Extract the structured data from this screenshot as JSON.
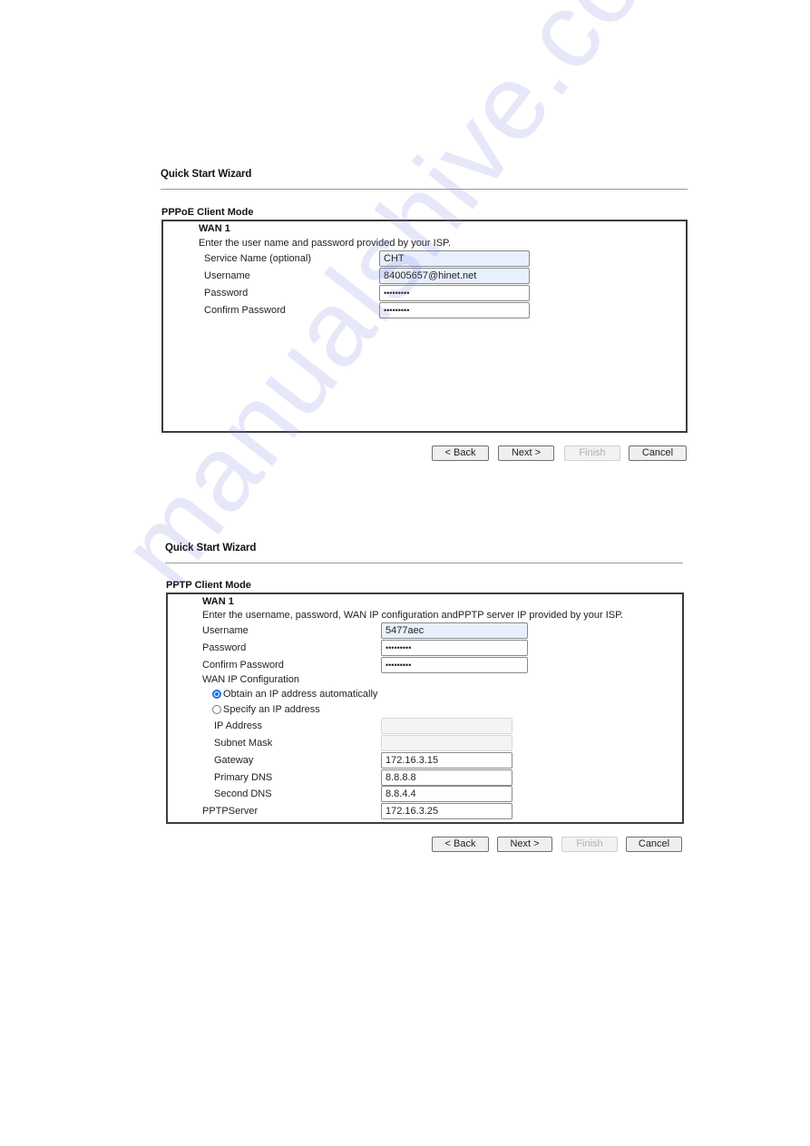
{
  "watermark": "manualshive.com",
  "pppoe": {
    "wizard_title": "Quick Start Wizard",
    "mode_title": "PPPoE Client Mode",
    "wan_label": "WAN 1",
    "description": "Enter the user name and password provided by your ISP.",
    "fields": {
      "service_name": {
        "label": "Service Name (optional)",
        "value": "CHT"
      },
      "username": {
        "label": "Username",
        "value": "84005657@hinet.net"
      },
      "password": {
        "label": "Password",
        "value": "•••••••••"
      },
      "confirm_password": {
        "label": "Confirm Password",
        "value": "•••••••••"
      }
    },
    "buttons": {
      "back": "< Back",
      "next": "Next >",
      "finish": "Finish",
      "cancel": "Cancel"
    }
  },
  "pptp": {
    "wizard_title": "Quick Start Wizard",
    "mode_title": "PPTP Client Mode",
    "wan_label": "WAN 1",
    "description": "Enter the username, password, WAN IP configuration andPPTP server IP provided by your ISP.",
    "fields": {
      "username": {
        "label": "Username",
        "value": "5477aec"
      },
      "password": {
        "label": "Password",
        "value": "•••••••••"
      },
      "confirm_password": {
        "label": "Confirm Password",
        "value": "•••••••••"
      }
    },
    "wan_ip_config": {
      "label": "WAN IP Configuration",
      "options": [
        {
          "label": "Obtain an IP address automatically",
          "selected": true
        },
        {
          "label": "Specify an IP address",
          "selected": false
        }
      ],
      "ip_address": {
        "label": "IP Address",
        "value": ""
      },
      "subnet_mask": {
        "label": "Subnet Mask",
        "value": ""
      },
      "gateway": {
        "label": "Gateway",
        "value": "172.16.3.15"
      },
      "primary_dns": {
        "label": "Primary DNS",
        "value": "8.8.8.8"
      },
      "second_dns": {
        "label": "Second DNS",
        "value": "8.8.4.4"
      }
    },
    "pptp_server": {
      "label": "PPTPServer",
      "value": "172.16.3.25"
    },
    "buttons": {
      "back": "< Back",
      "next": "Next >",
      "finish": "Finish",
      "cancel": "Cancel"
    }
  }
}
